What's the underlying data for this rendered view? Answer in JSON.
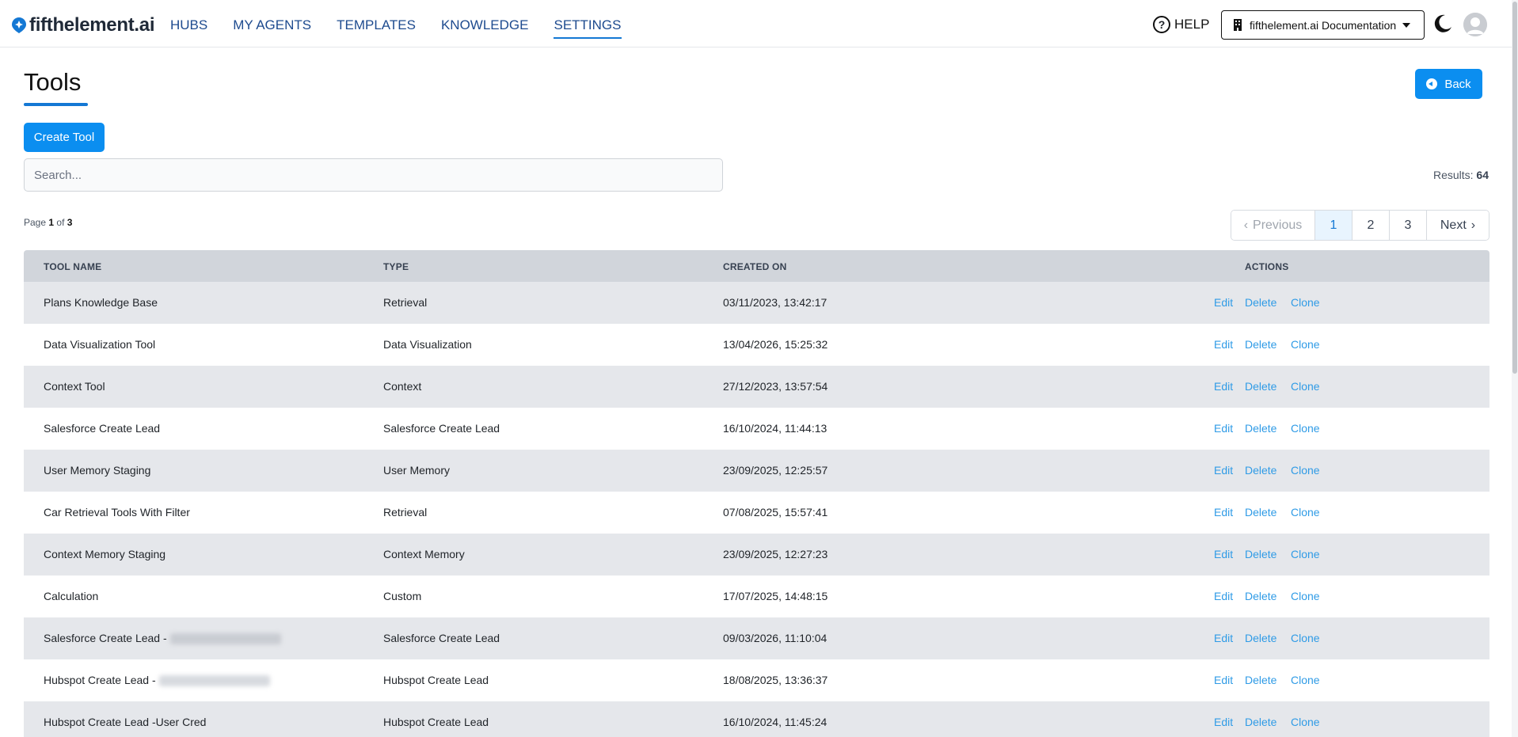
{
  "nav": {
    "logo_text": "fifthelement.ai",
    "links": [
      {
        "label": "HUBS"
      },
      {
        "label": "MY AGENTS"
      },
      {
        "label": "TEMPLATES"
      },
      {
        "label": "KNOWLEDGE"
      },
      {
        "label": "SETTINGS",
        "active": true
      }
    ],
    "help_label": "HELP",
    "org_selector": "fifthelement.ai Documentation"
  },
  "page": {
    "title": "Tools",
    "back_label": "Back",
    "create_label": "Create Tool",
    "search_placeholder": "Search...",
    "results_label": "Results:",
    "results_count": "64",
    "page_prefix": "Page",
    "page_current": "1",
    "page_of": "of",
    "page_total": "3"
  },
  "pagination": {
    "prev": "Previous",
    "pages": [
      "1",
      "2",
      "3"
    ],
    "next": "Next",
    "current": 1
  },
  "table": {
    "headers": [
      "TOOL NAME",
      "TYPE",
      "CREATED ON",
      "ACTIONS"
    ],
    "actions": [
      "Edit",
      "Delete",
      "Clone"
    ],
    "rows": [
      {
        "name": "Plans Knowledge Base",
        "type": "Retrieval",
        "created": "03/11/2023, 13:42:17"
      },
      {
        "name": "Data Visualization Tool",
        "type": "Data Visualization",
        "created": "13/04/2026, 15:25:32"
      },
      {
        "name": "Context Tool",
        "type": "Context",
        "created": "27/12/2023, 13:57:54"
      },
      {
        "name": "Salesforce Create Lead",
        "type": "Salesforce Create Lead",
        "created": "16/10/2024, 11:44:13"
      },
      {
        "name": "User Memory Staging",
        "type": "User Memory",
        "created": "23/09/2025, 12:25:57"
      },
      {
        "name": "Car Retrieval Tools With Filter",
        "type": "Retrieval",
        "created": "07/08/2025, 15:57:41"
      },
      {
        "name": "Context Memory Staging",
        "type": "Context Memory",
        "created": "23/09/2025, 12:27:23"
      },
      {
        "name": "Calculation",
        "type": "Custom",
        "created": "17/07/2025, 14:48:15"
      },
      {
        "name": "Salesforce Create Lead -",
        "type": "Salesforce Create Lead",
        "created": "09/03/2026, 11:10:04",
        "redacted": true
      },
      {
        "name": "Hubspot Create Lead -",
        "type": "Hubspot Create Lead",
        "created": "18/08/2025, 13:36:37",
        "redacted": true
      },
      {
        "name": "Hubspot Create Lead -User Cred",
        "type": "Hubspot Create Lead",
        "created": "16/10/2024, 11:45:24"
      }
    ]
  },
  "colors": {
    "primary": "#0b8ef0",
    "nav_link": "#1e4b8f",
    "action_link": "#2f9be6",
    "header_bg": "#d1d5db",
    "stripe_bg": "#e5e7eb"
  }
}
